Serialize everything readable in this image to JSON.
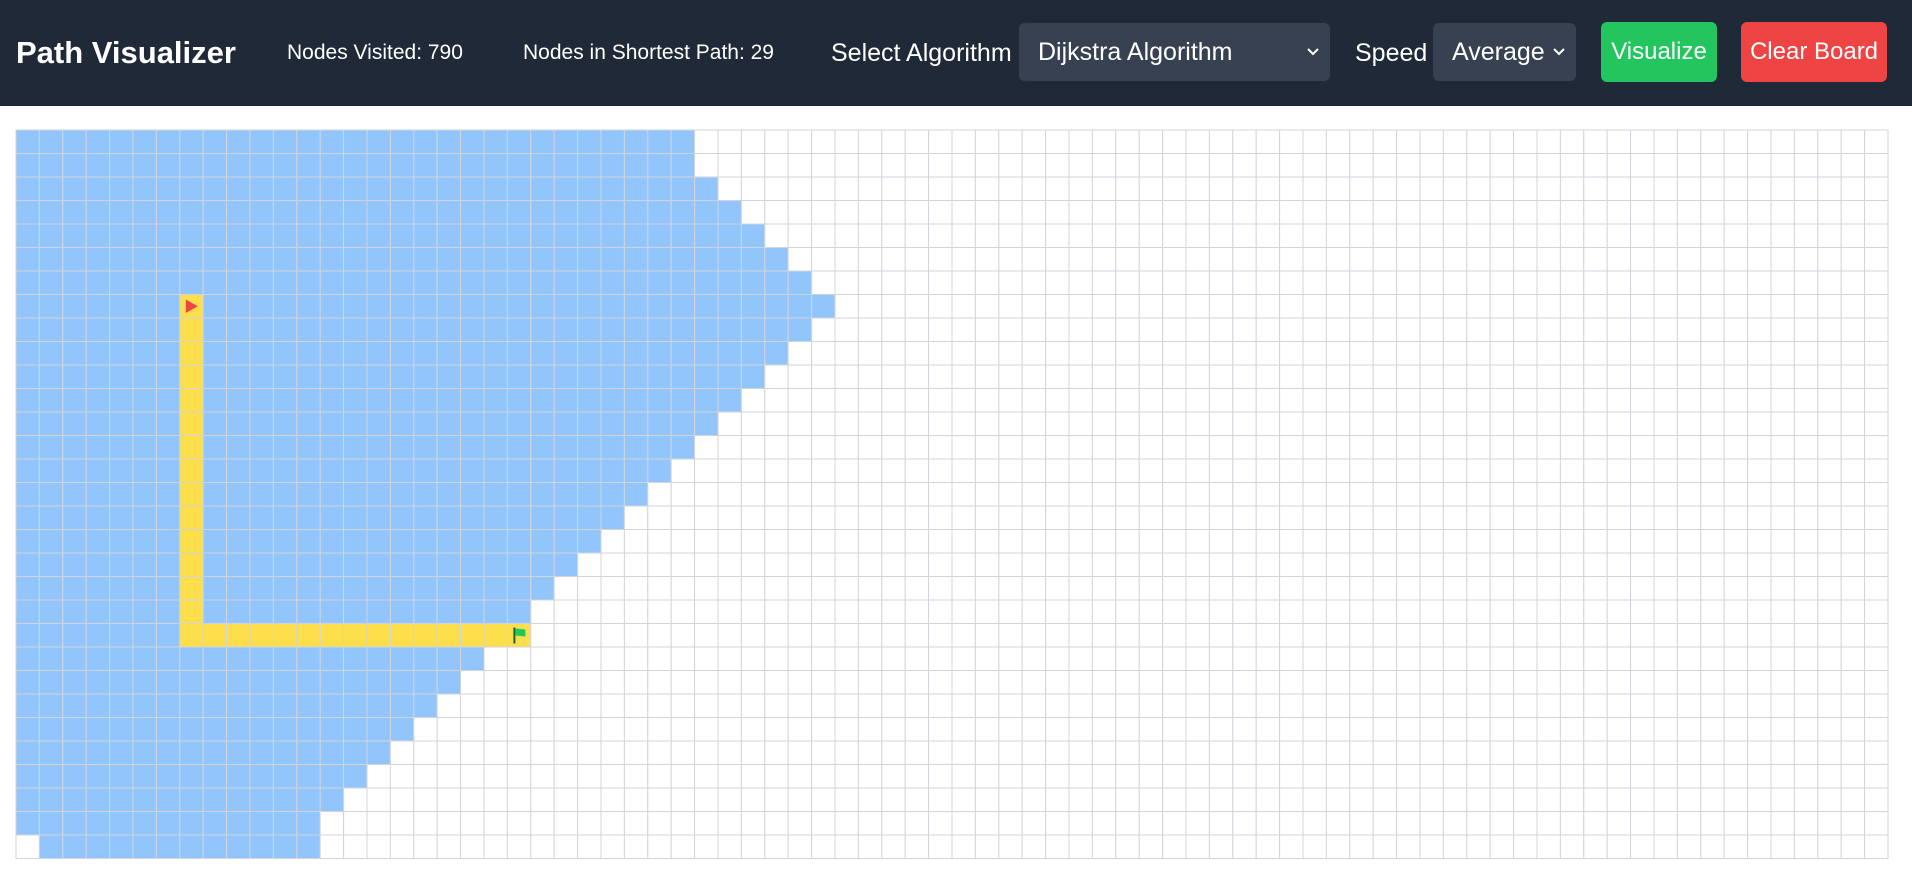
{
  "navbar": {
    "title": "Path Visualizer",
    "nodes_visited": "Nodes Visited: 790",
    "nodes_in_path": "Nodes in Shortest Path: 29",
    "algorithm_label": "Select Algorithm",
    "algorithm_value": "Dijkstra Algorithm",
    "speed_label": "Speed",
    "speed_value": "Average",
    "visualize_label": "Visualize",
    "clear_label": "Clear Board"
  },
  "colors": {
    "navbar_bg": "#1f2937",
    "select_bg": "#374151",
    "visualize": "#22c55e",
    "clear": "#ef4444",
    "visited": "#93c5fd",
    "path": "#fcdf4b",
    "grid_line": "#d1d5db",
    "start_marker": "#ef4444",
    "end_marker": "#22c55e"
  },
  "grid": {
    "rows": 31,
    "cols": 80,
    "start": {
      "row": 7,
      "col": 7,
      "icon": "play-triangle-icon"
    },
    "end": {
      "row": 21,
      "col": 21,
      "icon": "flag-icon"
    },
    "visited_extent_by_row": [
      28,
      28,
      29,
      30,
      31,
      32,
      33,
      34,
      33,
      32,
      31,
      30,
      29,
      28,
      27,
      26,
      25,
      24,
      23,
      22,
      21,
      20,
      19,
      18,
      17,
      16,
      15,
      14,
      13,
      12,
      [
        1,
        12
      ]
    ]
  }
}
